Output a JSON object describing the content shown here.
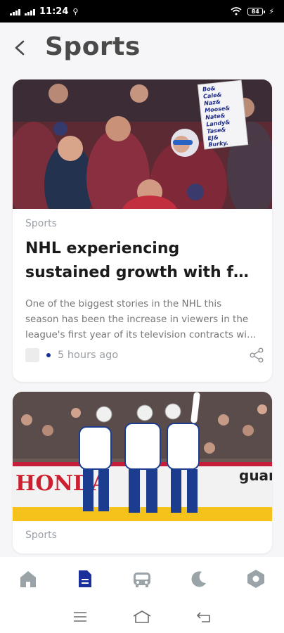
{
  "status_bar": {
    "time": "11:24",
    "battery": "84"
  },
  "header": {
    "title": "Sports"
  },
  "articles": [
    {
      "category": "Sports",
      "headline_line1": "NHL experiencing",
      "headline_line2": "sustained growth with f…",
      "summary_line1": "One of the biggest stories in the NHL this",
      "summary_line2": "season has been the increase in viewers in the",
      "summary_line3": "league's first year of its television contracts wi…",
      "time": "5 hours ago",
      "sign_text": [
        "Bo&",
        "Cale&",
        "Naz&",
        "Moose&",
        "Nate&",
        "Landy&",
        "Tase&",
        "EJ&",
        "Burky."
      ]
    },
    {
      "category": "Sports",
      "board_text": "HONDA",
      "board_text_right": "guar"
    }
  ],
  "colors": {
    "accent": "#1a2f9a",
    "nav_inactive": "#9aa3a8"
  },
  "bottom_nav": [
    {
      "icon": "home-icon"
    },
    {
      "icon": "document-icon"
    },
    {
      "icon": "bus-icon"
    },
    {
      "icon": "moon-icon"
    },
    {
      "icon": "settings-hexagon-icon"
    }
  ]
}
